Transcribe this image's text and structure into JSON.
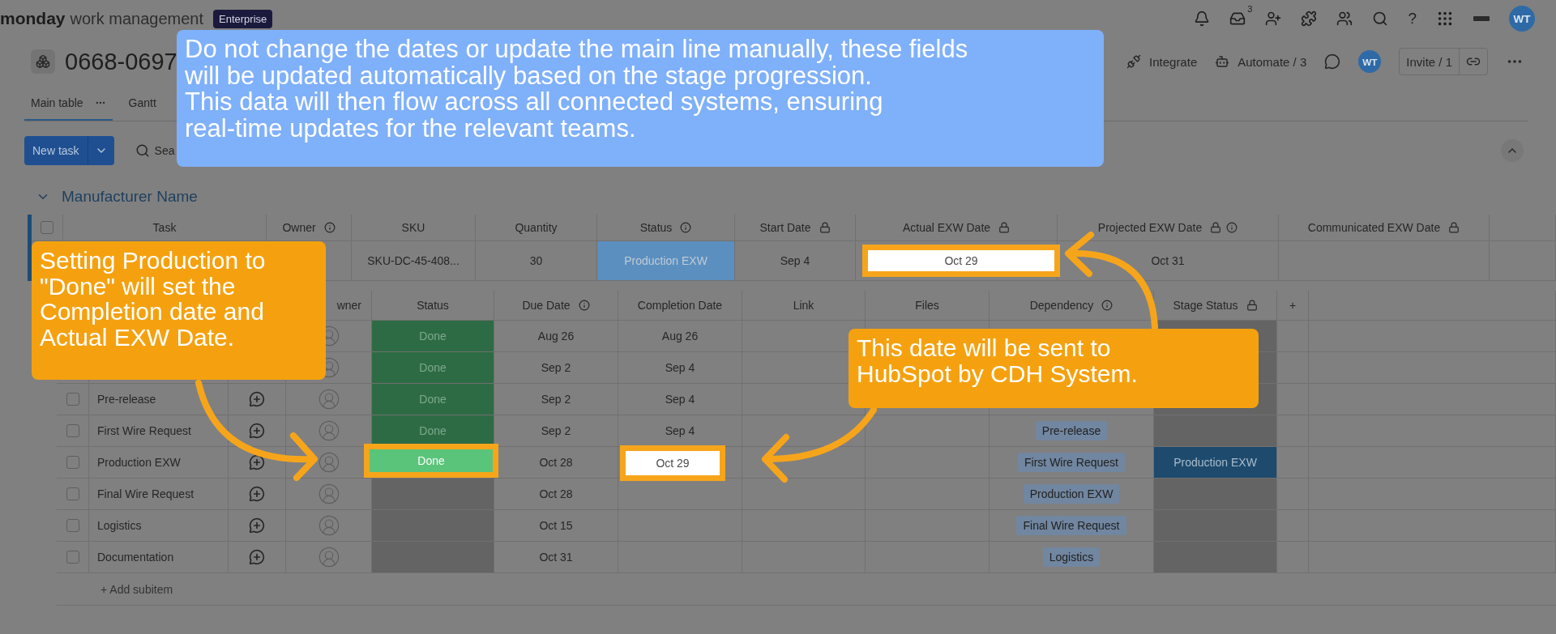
{
  "top_bar": {
    "brand": "monday",
    "product": "work management",
    "plan": "Enterprise",
    "inbox_count": "3",
    "help": "?",
    "avatar": "WT"
  },
  "board": {
    "title": "0668-0697",
    "actions": [
      {
        "kind": "integrate",
        "label": "Integrate"
      },
      {
        "kind": "automate",
        "label": "Automate / 3"
      }
    ],
    "avatar": "WT",
    "invite": "Invite / 1"
  },
  "views": [
    {
      "label": "Main table",
      "selected": true
    },
    {
      "label": "Gantt",
      "selected": false
    }
  ],
  "toolbar": {
    "new_task": "New task",
    "search": "Sea"
  },
  "group": {
    "title": "Manufacturer Name",
    "checked": false,
    "columns": [
      {
        "label": "Task"
      },
      {
        "label": "Owner",
        "info": true
      },
      {
        "label": "SKU"
      },
      {
        "label": "Quantity"
      },
      {
        "label": "Status",
        "info": true
      },
      {
        "label": "Start Date",
        "locked": true
      },
      {
        "label": "Actual EXW Date",
        "locked": true
      },
      {
        "label": "Projected EXW Date",
        "locked": true,
        "info": true
      },
      {
        "label": "Communicated EXW Date",
        "locked": true
      }
    ],
    "item": {
      "sku": "SKU-DC-45-408...",
      "quantity": "30",
      "status": {
        "label": "Production EXW",
        "color": "#5b8fbf"
      },
      "start": "Sep 4",
      "actual_exw": {
        "value": "Oct 29",
        "highlighted": true
      },
      "projected_exw": "Oct 31"
    }
  },
  "subitems": {
    "columns": [
      {
        "label": "wner"
      },
      {
        "label": "Status"
      },
      {
        "label": "Due Date",
        "info": true
      },
      {
        "label": "Completion Date"
      },
      {
        "label": "Link"
      },
      {
        "label": "Files"
      },
      {
        "label": "Dependency",
        "info": true
      },
      {
        "label": "Stage Status",
        "locked": true
      },
      {
        "label": "+"
      }
    ],
    "rows": [
      {
        "status": {
          "label": "Done",
          "color": "#2d6b44",
          "highlighted": false
        },
        "due": "Aug 26",
        "completion": {
          "value": "Aug 26",
          "highlighted": false
        }
      },
      {
        "status": {
          "label": "Done",
          "color": "#2d6b44",
          "highlighted": false
        },
        "due": "Sep 2",
        "completion": {
          "value": "Sep 4",
          "highlighted": false
        }
      },
      {
        "name": "Pre-release",
        "checked": false,
        "status": {
          "label": "Done",
          "color": "#2d6b44",
          "highlighted": false
        },
        "due": "Sep 2",
        "completion": {
          "value": "Sep 4",
          "highlighted": false
        }
      },
      {
        "name": "First Wire Request",
        "checked": false,
        "status": {
          "label": "Done",
          "color": "#2d6b44",
          "highlighted": false
        },
        "due": "Sep 2",
        "completion": {
          "value": "Sep 4",
          "highlighted": false
        },
        "dependency": "Pre-release"
      },
      {
        "name": "Production EXW",
        "checked": false,
        "status": {
          "label": "Done",
          "color": "#5ac47a",
          "highlighted": true
        },
        "due": "Oct 28",
        "completion": {
          "value": "Oct 29",
          "highlighted": true
        },
        "dependency": "First Wire Request",
        "stage": {
          "label": "Production EXW",
          "color": "#1e4a6e"
        }
      },
      {
        "name": "Final Wire Request",
        "checked": false,
        "due": "Oct 28",
        "dependency": "Production EXW"
      },
      {
        "name": "Logistics",
        "checked": false,
        "due": "Oct 15",
        "dependency": "Final Wire Request"
      },
      {
        "name": "Documentation",
        "checked": false,
        "due": "Oct 31",
        "dependency": "Logistics"
      }
    ],
    "add": "+ Add subitem"
  },
  "callouts": [
    {
      "kind": "banner",
      "text": "Do not change the dates or update the main line manually, these fields\nwill be updated automatically based on the stage progression.\nThis data will then flow across all connected systems, ensuring\nreal-time updates for the relevant teams."
    },
    {
      "kind": "tip",
      "text": "Setting Production to\n\"Done\" will set the\nCompletion date and\nActual EXW Date."
    },
    {
      "kind": "tip",
      "text": "This date will be sent to\nHubSpot by CDH System."
    }
  ]
}
